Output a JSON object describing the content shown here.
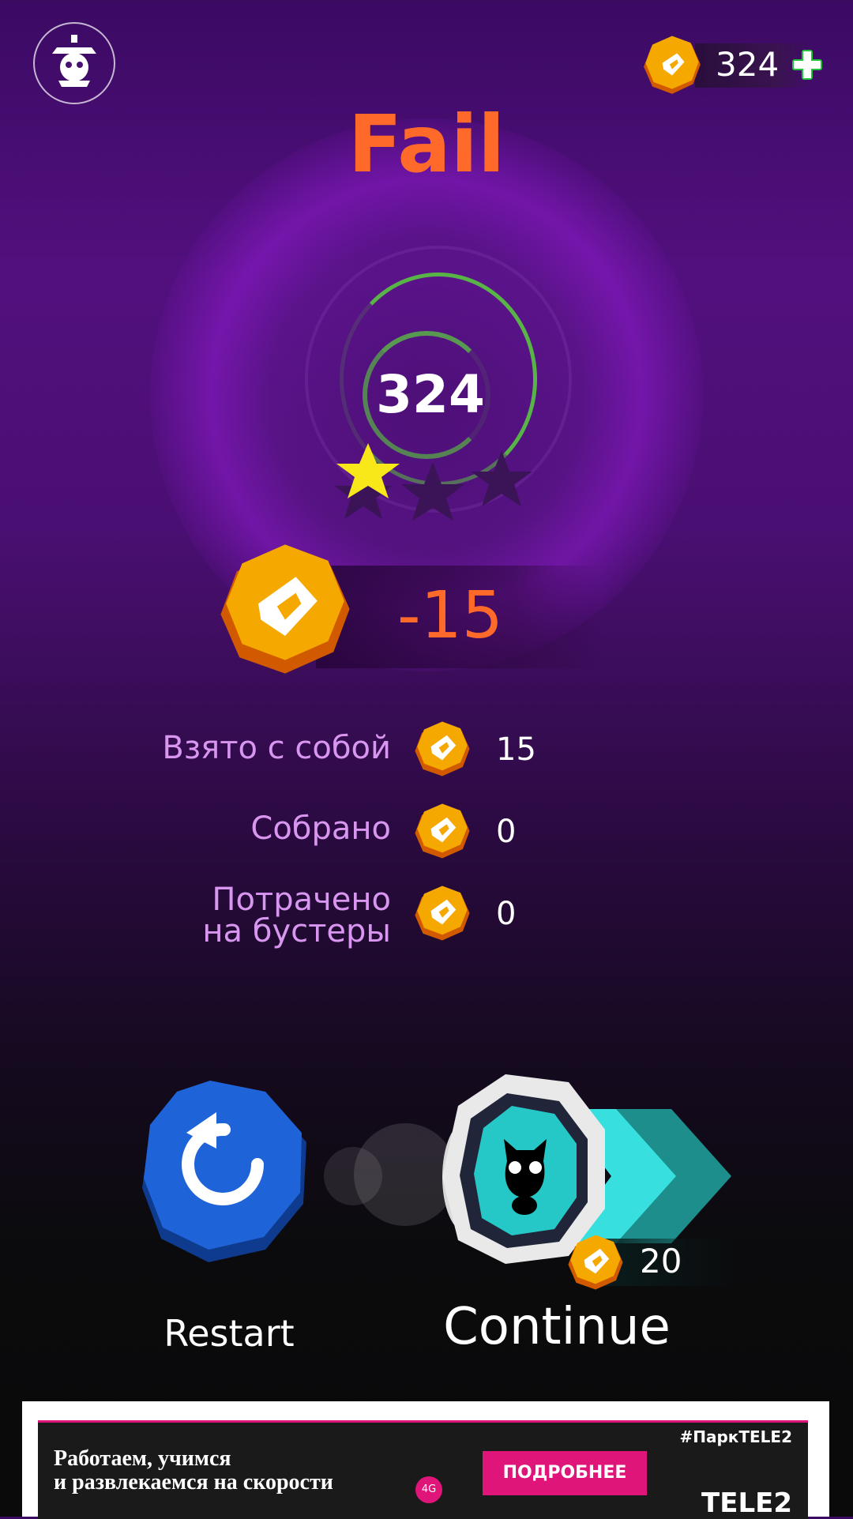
{
  "header": {
    "coin_balance": "324",
    "result_title": "Fail"
  },
  "score": {
    "value": "324",
    "stars_earned": 1,
    "stars_total": 3
  },
  "coin_change": "-15",
  "stats": [
    {
      "label_line1": "Взято с собой",
      "label_line2": "",
      "value": "15"
    },
    {
      "label_line1": "Собрано",
      "label_line2": "",
      "value": "0"
    },
    {
      "label_line1": "Потрачено",
      "label_line2": "на бустеры",
      "value": "0"
    }
  ],
  "actions": {
    "restart_label": "Restart",
    "continue_label": "Continue",
    "continue_cost": "20"
  },
  "ad": {
    "line1": "Работаем, учимся",
    "line2": "и развлекаемся на скорости",
    "badge": "4G",
    "button": "ПОДРОБНЕЕ",
    "hashtag": "#ПаркTELE2",
    "brand": "TELE2"
  },
  "colors": {
    "accent_orange": "#ff6a2b",
    "coin_gold": "#f5a000",
    "label_pink": "#d896f0",
    "restart_blue": "#1f63d8",
    "continue_teal": "#2ad8d8"
  },
  "icons": [
    "settings-robot-icon",
    "coin-icon",
    "plus-icon",
    "star-icon",
    "restart-icon",
    "cat-icon",
    "chevron-right-icon"
  ]
}
